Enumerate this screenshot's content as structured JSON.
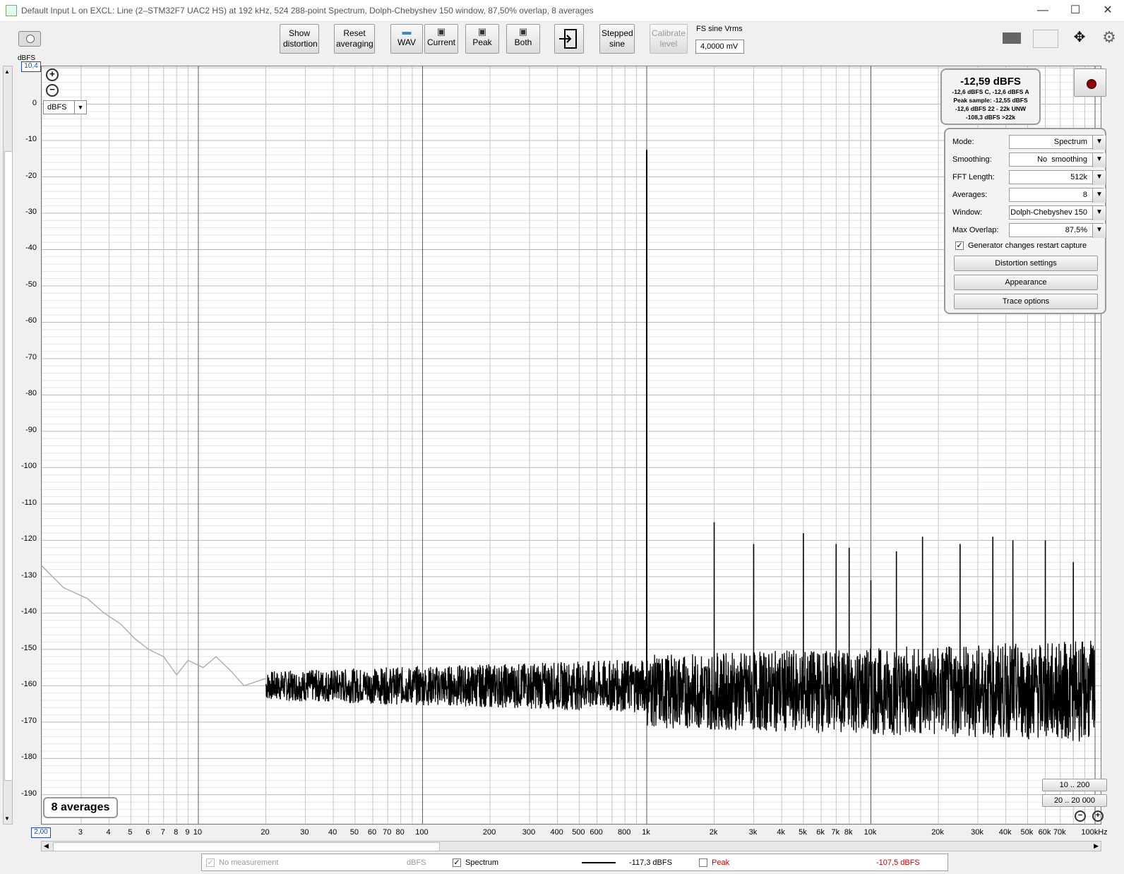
{
  "window": {
    "title": "Default Input L on EXCL: Line (2–STM32F7 UAC2 HS) at 192 kHz, 524 288-point Spectrum, Dolph-Chebyshev 150 window, 87,50% overlap, 8 averages",
    "minimize": "—",
    "maximize": "☐",
    "close": "✕"
  },
  "toolbar": {
    "show_distortion": "Show distortion",
    "reset_averaging": "Reset averaging",
    "wav": "WAV",
    "current": "Current",
    "peak": "Peak",
    "both": "Both",
    "stepped_sine": "Stepped sine",
    "calibrate_level": "Calibrate level",
    "fs_label": "FS sine Vrms",
    "fs_value": "4,0000 mV"
  },
  "plot": {
    "y_unit_label": "dBFS",
    "y_top_box": "10,4",
    "x_left_box": "2,00",
    "units_select": "dBFS",
    "averages_badge": "8 averages",
    "range_btn_1": "10 .. 200",
    "range_btn_2": "20 .. 20 000"
  },
  "level_box": {
    "main": "-12,59 dBFS",
    "line1": "-12,6 dBFS C, -12,6 dBFS A",
    "line2": "Peak sample: -12,55 dBFS",
    "line3": "-12,6 dBFS 22 - 22k UNW",
    "line4": "-108,3 dBFS >22k"
  },
  "settings": {
    "mode_label": "Mode:",
    "mode_value": "Spectrum",
    "smoothing_label": "Smoothing:",
    "smoothing_value": "No  smoothing",
    "fft_label": "FFT Length:",
    "fft_value": "512k",
    "averages_label": "Averages:",
    "averages_value": "8",
    "window_label": "Window:",
    "window_value": "Dolph-Chebyshev 150",
    "overlap_label": "Max Overlap:",
    "overlap_value": "87.5%",
    "generator_restart": "Generator changes restart capture",
    "generator_checked": true,
    "distortion_settings": "Distortion settings",
    "appearance": "Appearance",
    "trace_options": "Trace options"
  },
  "legend": {
    "no_measurement": "No measurement",
    "no_measurement_unit": "dBFS",
    "spectrum": "Spectrum",
    "spectrum_value": "-117,3 dBFS",
    "peak": "Peak",
    "peak_value": "-107,5 dBFS",
    "peak_color": "#cc0000"
  },
  "chart_data": {
    "type": "line",
    "title": "",
    "xlabel": "",
    "ylabel": "dBFS",
    "xscale": "log",
    "xlim": [
      2,
      100000
    ],
    "ylim": [
      -198,
      10.4
    ],
    "y_ticks": [
      0,
      -10,
      -20,
      -30,
      -40,
      -50,
      -60,
      -70,
      -80,
      -90,
      -100,
      -110,
      -120,
      -130,
      -140,
      -150,
      -160,
      -170,
      -180,
      -190
    ],
    "x_ticks": [
      "3",
      "4",
      "5",
      "6",
      "7",
      "8",
      "9",
      "10",
      "20",
      "30",
      "40",
      "50",
      "60",
      "70",
      "80",
      "100",
      "200",
      "300",
      "400",
      "500",
      "600",
      "800",
      "1k",
      "2k",
      "3k",
      "4k",
      "5k",
      "6k",
      "7k",
      "8k",
      "10k",
      "20k",
      "30k",
      "40k",
      "50k",
      "60k",
      "70k",
      "100kHz"
    ],
    "x_tick_values": [
      3,
      4,
      5,
      6,
      7,
      8,
      9,
      10,
      20,
      30,
      40,
      50,
      60,
      70,
      80,
      100,
      200,
      300,
      400,
      500,
      600,
      800,
      1000,
      2000,
      3000,
      4000,
      5000,
      6000,
      7000,
      8000,
      10000,
      20000,
      30000,
      40000,
      50000,
      60000,
      70000,
      100000
    ],
    "grid": true,
    "series": [
      {
        "name": "Spectrum",
        "color": "#000000",
        "low_freq_color": "#b0b0b0",
        "noise_floor_db": -160,
        "fundamental": {
          "x": 1000,
          "y": -12.6
        },
        "spurs": [
          {
            "x": 2000,
            "y": -115
          },
          {
            "x": 3000,
            "y": -121
          },
          {
            "x": 5000,
            "y": -118
          },
          {
            "x": 7000,
            "y": -121
          },
          {
            "x": 8000,
            "y": -122
          },
          {
            "x": 10000,
            "y": -131
          },
          {
            "x": 13000,
            "y": -123
          },
          {
            "x": 17000,
            "y": -119
          },
          {
            "x": 25000,
            "y": -121
          },
          {
            "x": 35000,
            "y": -119
          },
          {
            "x": 43000,
            "y": -120
          },
          {
            "x": 60000,
            "y": -120
          },
          {
            "x": 80000,
            "y": -126
          }
        ],
        "low_freq_steps": [
          {
            "x": 2,
            "y": -127
          },
          {
            "x": 2.5,
            "y": -133
          },
          {
            "x": 3.2,
            "y": -136
          },
          {
            "x": 3.8,
            "y": -140
          },
          {
            "x": 4.5,
            "y": -143
          },
          {
            "x": 5.2,
            "y": -147
          },
          {
            "x": 6,
            "y": -150
          },
          {
            "x": 7,
            "y": -152
          },
          {
            "x": 8,
            "y": -157
          },
          {
            "x": 9,
            "y": -153
          },
          {
            "x": 10.5,
            "y": -155
          },
          {
            "x": 12,
            "y": -152
          },
          {
            "x": 14,
            "y": -156
          },
          {
            "x": 16,
            "y": -160
          },
          {
            "x": 20,
            "y": -158
          }
        ]
      }
    ]
  }
}
